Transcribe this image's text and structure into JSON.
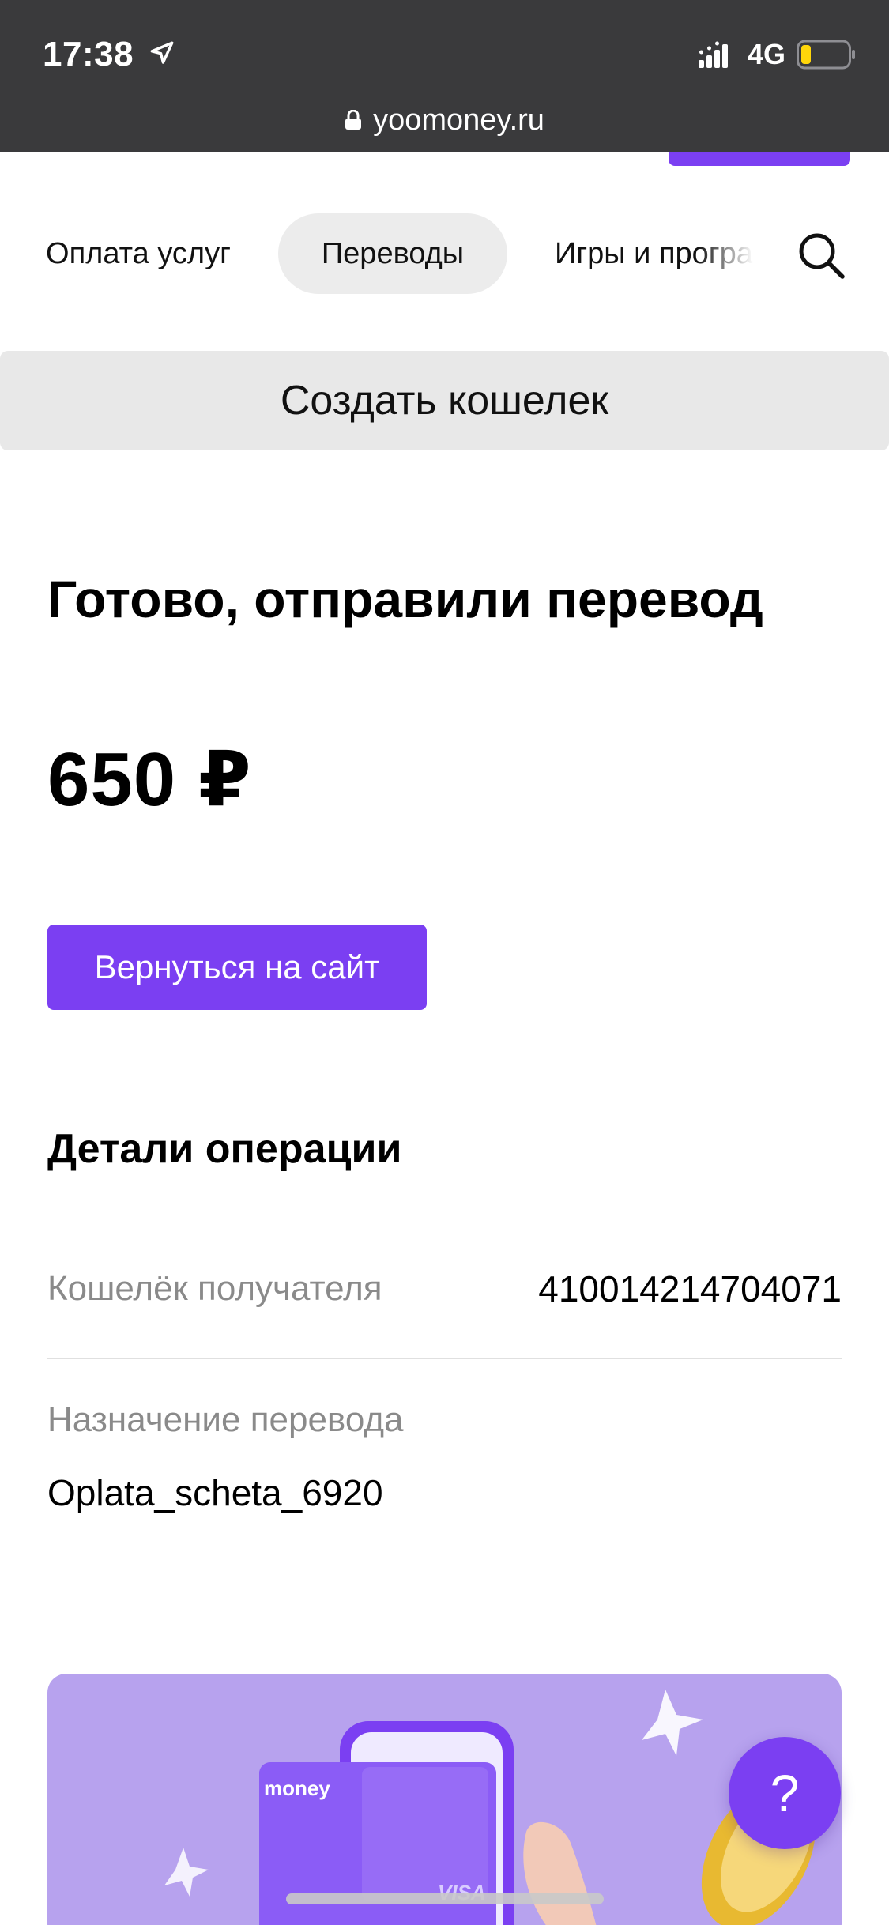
{
  "status_bar": {
    "time": "17:38",
    "network": "4G",
    "icons": [
      "location-arrow-icon",
      "signal-icon",
      "battery-icon"
    ]
  },
  "browser": {
    "url": "yoomoney.ru",
    "lock_icon": "lock-icon"
  },
  "nav": {
    "tabs": [
      {
        "label": "Оплата услуг"
      },
      {
        "label": "Переводы"
      },
      {
        "label": "Игры и програ"
      }
    ],
    "active_tab": "Переводы",
    "search_icon": "search-icon"
  },
  "create_wallet_label": "Создать кошелек",
  "result": {
    "headline": "Готово, отправили перевод",
    "amount": "650 ₽",
    "back_button_label": "Вернуться на сайт"
  },
  "details": {
    "title": "Детали операции",
    "rows": [
      {
        "label": "Кошелёк получателя",
        "value": "410014214704071"
      },
      {
        "label": "Назначение перевода",
        "value": "Oplata_scheta_6920"
      }
    ]
  },
  "promo": {
    "brand": "money",
    "card_network": "VISA"
  },
  "help_button_label": "?",
  "colors": {
    "accent": "#7b3ff2",
    "chrome_bg": "#3a3a3c",
    "promo_bg": "#b7a2ee",
    "muted_text": "#8a8a8a"
  }
}
